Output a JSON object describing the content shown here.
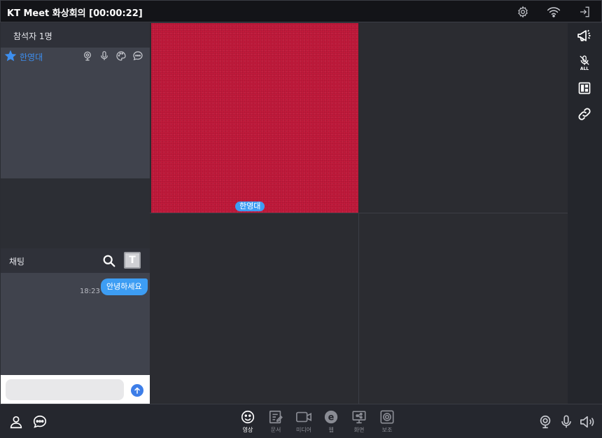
{
  "window": {
    "title": "KT Meet 화상회의 [00:00:22]"
  },
  "participants": {
    "header": "참석자 1명",
    "list": [
      {
        "name": "한영대",
        "role_icon": "star-icon"
      }
    ]
  },
  "chat": {
    "title": "채팅",
    "toggle_label": "T",
    "messages": [
      {
        "time": "18:23",
        "text": "안녕하세요"
      }
    ],
    "input_value": "",
    "input_placeholder": ""
  },
  "video": {
    "tiles": [
      {
        "name": "한영대",
        "color": "#c11a3b"
      },
      {
        "name": ""
      },
      {
        "name": ""
      },
      {
        "name": ""
      }
    ]
  },
  "right_toolbar": {
    "mute_all_label": "ALL"
  },
  "bottom_toolbar": {
    "tools": [
      {
        "label": "영상",
        "icon": "smile-icon",
        "active": true
      },
      {
        "label": "문서",
        "icon": "document-icon",
        "active": false
      },
      {
        "label": "미디어",
        "icon": "media-icon",
        "active": false
      },
      {
        "label": "웹",
        "icon": "web-icon",
        "active": false
      },
      {
        "label": "화면",
        "icon": "screen-share-icon",
        "active": false
      },
      {
        "label": "보조",
        "icon": "assist-icon",
        "active": false
      }
    ]
  },
  "colors": {
    "accent": "#3d9df3",
    "participant_name": "#3d8ff0",
    "video_tile": "#c11a3b"
  }
}
